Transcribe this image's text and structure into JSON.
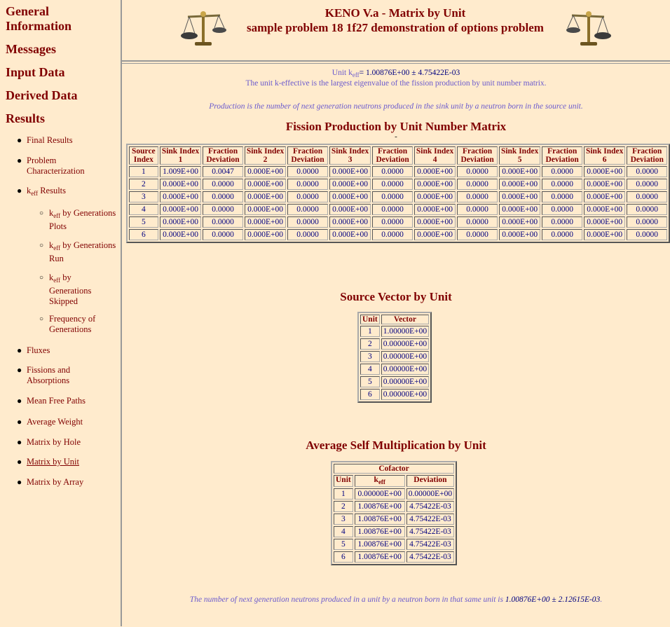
{
  "header": {
    "title": "KENO V.a - Matrix by Unit",
    "subtitle": "sample problem 18 1f27 demonstration of options problem"
  },
  "sidebar": {
    "general_information": "General Information",
    "messages": "Messages",
    "input_data": "Input Data",
    "derived_data": "Derived Data",
    "results": "Results",
    "items": {
      "final_results": "Final Results",
      "problem_characterization": "Problem Characterization",
      "keff_results_k": "k",
      "keff_results_sub": "eff",
      "keff_results_text": " Results",
      "keff_gen_plots_k": "k",
      "keff_gen_plots_sub": "eff",
      "keff_gen_plots_text": " by Generations Plots",
      "keff_gen_run_k": "k",
      "keff_gen_run_sub": "eff",
      "keff_gen_run_text": " by Generations Run",
      "keff_gen_skipped_k": "k",
      "keff_gen_skipped_sub": "eff",
      "keff_gen_skipped_text": " by Generations Skipped",
      "freq_generations": "Frequency of Generations",
      "fluxes": "Fluxes",
      "fissions_absorptions": "Fissions and Absorptions",
      "mean_free_paths": "Mean Free Paths",
      "average_weight": "Average Weight",
      "matrix_by_hole": "Matrix by Hole",
      "matrix_by_unit": "Matrix by Unit",
      "matrix_by_array": "Matrix by Array"
    }
  },
  "main": {
    "unit_keff_prefix": "Unit k",
    "unit_keff_sub": "eff",
    "unit_keff_value": "= 1.00876E+00 ± 4.75422E-03",
    "keff_description": "The unit k-effective is the largest eigenvalue of the fission production by unit number matrix.",
    "production_note": "Production is the number of next generation neutrons produced in the sink unit by a neutron born in the source unit.",
    "fission_title": "Fission Production by Unit Number Matrix",
    "fission_dash": "-",
    "fission_headers": [
      "Source Index",
      "Sink Index 1",
      "Fraction Deviation",
      "Sink Index 2",
      "Fraction Deviation",
      "Sink Index 3",
      "Fraction Deviation",
      "Sink Index 4",
      "Fraction Deviation",
      "Sink Index 5",
      "Fraction Deviation",
      "Sink Index 6",
      "Fraction Deviation"
    ],
    "fission_rows": [
      [
        "1",
        "1.009E+00",
        "0.0047",
        "0.000E+00",
        "0.0000",
        "0.000E+00",
        "0.0000",
        "0.000E+00",
        "0.0000",
        "0.000E+00",
        "0.0000",
        "0.000E+00",
        "0.0000"
      ],
      [
        "2",
        "0.000E+00",
        "0.0000",
        "0.000E+00",
        "0.0000",
        "0.000E+00",
        "0.0000",
        "0.000E+00",
        "0.0000",
        "0.000E+00",
        "0.0000",
        "0.000E+00",
        "0.0000"
      ],
      [
        "3",
        "0.000E+00",
        "0.0000",
        "0.000E+00",
        "0.0000",
        "0.000E+00",
        "0.0000",
        "0.000E+00",
        "0.0000",
        "0.000E+00",
        "0.0000",
        "0.000E+00",
        "0.0000"
      ],
      [
        "4",
        "0.000E+00",
        "0.0000",
        "0.000E+00",
        "0.0000",
        "0.000E+00",
        "0.0000",
        "0.000E+00",
        "0.0000",
        "0.000E+00",
        "0.0000",
        "0.000E+00",
        "0.0000"
      ],
      [
        "5",
        "0.000E+00",
        "0.0000",
        "0.000E+00",
        "0.0000",
        "0.000E+00",
        "0.0000",
        "0.000E+00",
        "0.0000",
        "0.000E+00",
        "0.0000",
        "0.000E+00",
        "0.0000"
      ],
      [
        "6",
        "0.000E+00",
        "0.0000",
        "0.000E+00",
        "0.0000",
        "0.000E+00",
        "0.0000",
        "0.000E+00",
        "0.0000",
        "0.000E+00",
        "0.0000",
        "0.000E+00",
        "0.0000"
      ]
    ],
    "source_title": "Source Vector by Unit",
    "source_headers": [
      "Unit",
      "Vector"
    ],
    "source_rows": [
      [
        "1",
        "1.00000E+00"
      ],
      [
        "2",
        "0.00000E+00"
      ],
      [
        "3",
        "0.00000E+00"
      ],
      [
        "4",
        "0.00000E+00"
      ],
      [
        "5",
        "0.00000E+00"
      ],
      [
        "6",
        "0.00000E+00"
      ]
    ],
    "selfmult_title": "Average Self Multiplication by Unit",
    "selfmult_group": "Cofactor",
    "selfmult_h_unit": "Unit",
    "selfmult_h_k": "k",
    "selfmult_h_ksub": "eff",
    "selfmult_h_dev": "Deviation",
    "selfmult_rows": [
      [
        "1",
        "0.00000E+00",
        "0.00000E+00"
      ],
      [
        "2",
        "1.00876E+00",
        "4.75422E-03"
      ],
      [
        "3",
        "1.00876E+00",
        "4.75422E-03"
      ],
      [
        "4",
        "1.00876E+00",
        "4.75422E-03"
      ],
      [
        "5",
        "1.00876E+00",
        "4.75422E-03"
      ],
      [
        "6",
        "1.00876E+00",
        "4.75422E-03"
      ]
    ],
    "footer_text": "The number of next generation neutrons produced in a unit by a neutron born in that same unit is ",
    "footer_value": "1.00876E+00 ± 2.12615E-03",
    "footer_end": "."
  }
}
